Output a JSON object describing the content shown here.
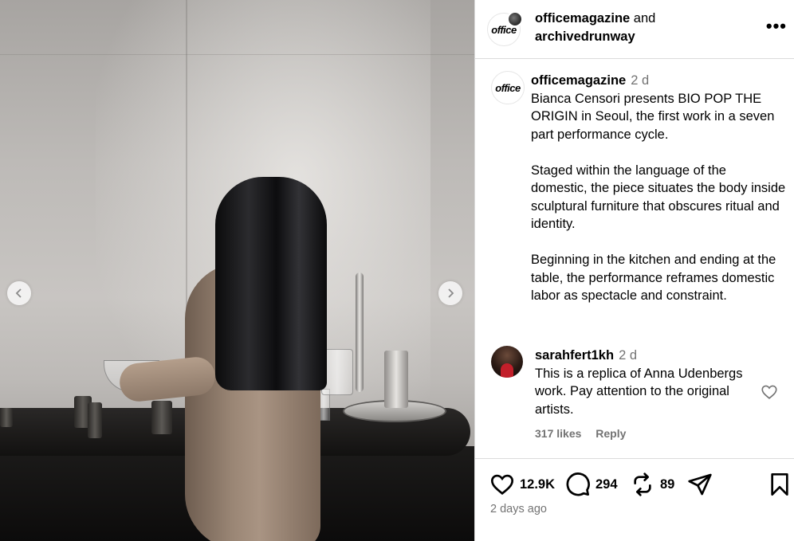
{
  "media": {
    "prev_icon": "chevron-left-icon",
    "next_icon": "chevron-right-icon"
  },
  "header": {
    "avatar_text": "office",
    "user1": "officemagazine",
    "conjunction": "and",
    "user2": "archivedrunway",
    "more_icon": "more-horizontal-icon",
    "more_text": "•••"
  },
  "caption": {
    "avatar_text": "office",
    "username": "officemagazine",
    "time": "2 d",
    "paragraphs": [
      "Bianca Censori presents BIO POP THE ORIGIN in Seoul, the first work in a seven part performance cycle.",
      "Staged within the language of the domestic, the piece situates the body inside sculptural furniture that obscures ritual and identity.",
      "Beginning in the kitchen and ending at the table, the performance reframes domestic labor as spectacle and constraint."
    ]
  },
  "comment": {
    "username": "sarahfert1kh",
    "time": "2 d",
    "text": "This is a replica of Anna Udenbergs work. Pay attention to the original artists.",
    "likes": "317 likes",
    "reply": "Reply",
    "like_icon": "heart-outline-icon"
  },
  "actions": {
    "likes": "12.9K",
    "comments": "294",
    "reposts": "89",
    "like_icon": "heart-icon",
    "comment_icon": "comment-icon",
    "repost_icon": "repost-icon",
    "share_icon": "send-icon",
    "save_icon": "bookmark-icon"
  },
  "posted": "2 days ago"
}
